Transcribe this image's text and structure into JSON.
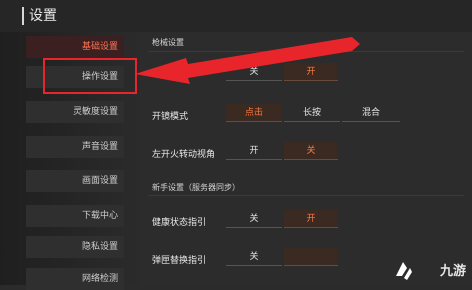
{
  "header": {
    "title": "设置"
  },
  "sidebar": {
    "items": [
      {
        "label": "基础设置",
        "active": true
      },
      {
        "label": "操作设置",
        "active": false
      },
      {
        "label": "灵敏度设置",
        "active": false
      },
      {
        "label": "声音设置",
        "active": false
      },
      {
        "label": "画面设置",
        "active": false
      },
      {
        "label": "下载中心",
        "active": false
      },
      {
        "label": "隐私设置",
        "active": false
      },
      {
        "label": "网络检测",
        "active": false
      }
    ]
  },
  "main": {
    "section_fire": "枪械设置",
    "rows": [
      {
        "label": "",
        "options": [
          "关",
          "开"
        ],
        "selected": 1
      },
      {
        "label": "开镜模式",
        "options": [
          "点击",
          "长按",
          "混合"
        ],
        "selected": 0
      },
      {
        "label": "左开火转动视角",
        "options": [
          "开",
          "关"
        ],
        "selected": 1
      }
    ],
    "section_newbie": "新手设置（服务器同步）",
    "rows2": [
      {
        "label": "健康状态指引",
        "options": [
          "关",
          "开"
        ],
        "selected": 1
      },
      {
        "label": "弹匣替换指引",
        "options": [
          "关",
          ""
        ],
        "selected": 1
      }
    ]
  },
  "watermark": {
    "text": "九游"
  },
  "colors": {
    "accent": "#ff7a42",
    "annotation_red": "#e8252b",
    "active_nav": "#ff7458"
  }
}
